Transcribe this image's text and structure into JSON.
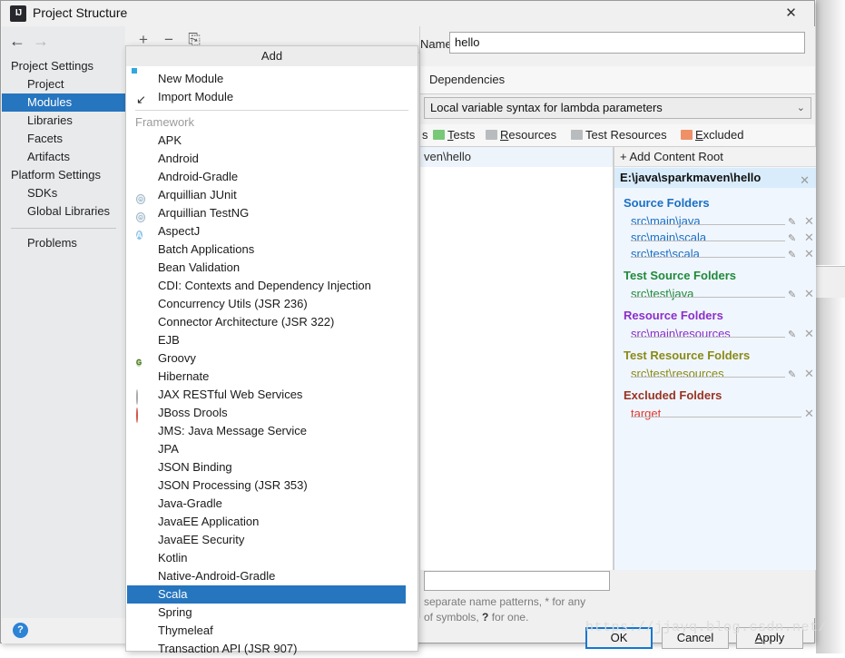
{
  "window": {
    "title": "Project Structure",
    "app_icon": "IJ",
    "close_icon": "✕"
  },
  "nav": {
    "back_icon": "←",
    "forward_icon": "→",
    "groups": [
      {
        "label": "Project Settings",
        "items": [
          {
            "label": "Project",
            "selected": false
          },
          {
            "label": "Modules",
            "selected": true
          },
          {
            "label": "Libraries",
            "selected": false
          },
          {
            "label": "Facets",
            "selected": false
          },
          {
            "label": "Artifacts",
            "selected": false
          }
        ]
      },
      {
        "label": "Platform Settings",
        "items": [
          {
            "label": "SDKs",
            "selected": false
          },
          {
            "label": "Global Libraries",
            "selected": false
          }
        ]
      }
    ],
    "problems": "Problems",
    "help_icon": "?"
  },
  "module_toolbar": {
    "add_icon": "+",
    "remove_icon": "−",
    "copy_icon": "⎘"
  },
  "right": {
    "name_label": "Name:",
    "name_value": "hello",
    "tabs": [
      {
        "label": "Dependencies",
        "selected": false
      }
    ],
    "language_level": "Local variable syntax for lambda parameters",
    "combo_arrow": "⌄",
    "mark_as": [
      {
        "label": "s",
        "color": "",
        "accesskey": ""
      },
      {
        "label": "Tests",
        "color": "#78c878",
        "accesskey": "T"
      },
      {
        "label": "Resources",
        "color": "#b9bcbf",
        "accesskey": "R"
      },
      {
        "label": "Test Resources",
        "color": "#b9bcbf",
        "accesskey": ""
      },
      {
        "label": "Excluded",
        "color": "#ef9068",
        "accesskey": "E"
      }
    ],
    "tree_root": "ven\\hello",
    "add_content_root": "+ Add Content Root",
    "add_content_root_accesskey": "C",
    "content_root_path": "E:\\java\\sparkmaven\\hello",
    "close_icon": "✕",
    "edit_icon": "✎",
    "folder_groups": [
      {
        "title": "Source Folders",
        "color": "#1a6fc4",
        "items": [
          {
            "path": "src\\main\\java",
            "has_edit": true
          },
          {
            "path": "src\\main\\scala",
            "has_edit": true
          },
          {
            "path": "src\\test\\scala",
            "has_edit": true
          }
        ]
      },
      {
        "title": "Test Source Folders",
        "color": "#1f8a3b",
        "items": [
          {
            "path": "src\\test\\java",
            "has_edit": true
          }
        ]
      },
      {
        "title": "Resource Folders",
        "color": "#8b2fc9",
        "items": [
          {
            "path": "src\\main\\resources",
            "has_edit": true
          }
        ]
      },
      {
        "title": "Test Resource Folders",
        "color": "#8a8a16",
        "items": [
          {
            "path": "src\\test\\resources",
            "has_edit": true
          }
        ]
      },
      {
        "title": "Excluded Folders",
        "color": "#993322",
        "items": [
          {
            "path": "target",
            "has_edit": false
          }
        ]
      }
    ],
    "exclude_hint_line1": "separate name patterns, * for any",
    "exclude_hint_line2_a": "of symbols, ",
    "exclude_hint_line2_b": "?",
    "exclude_hint_line2_c": " for one.",
    "buttons": [
      {
        "label": "OK",
        "default": true,
        "accesskey": ""
      },
      {
        "label": "Cancel",
        "default": false,
        "accesskey": ""
      },
      {
        "label": "Apply",
        "default": false,
        "accesskey": "A"
      }
    ]
  },
  "add_popup": {
    "title": "Add",
    "top_items": [
      {
        "label": "New Module",
        "icon": "new-module-icon"
      },
      {
        "label": "Import Module",
        "icon": "import-module-icon"
      }
    ],
    "category": "Framework",
    "items": [
      {
        "label": "APK",
        "icon": "android-icon",
        "selected": false
      },
      {
        "label": "Android",
        "icon": "android-icon",
        "selected": false
      },
      {
        "label": "Android-Gradle",
        "icon": "android-icon",
        "selected": false
      },
      {
        "label": "Arquillian JUnit",
        "icon": "arquillian-icon",
        "selected": false
      },
      {
        "label": "Arquillian TestNG",
        "icon": "arquillian-icon",
        "selected": false
      },
      {
        "label": "AspectJ",
        "icon": "aspectj-icon",
        "selected": false
      },
      {
        "label": "Batch Applications",
        "icon": "batch-icon",
        "selected": false
      },
      {
        "label": "Bean Validation",
        "icon": "bean-validation-icon",
        "selected": false
      },
      {
        "label": "CDI: Contexts and Dependency Injection",
        "icon": "cdi-icon",
        "selected": false
      },
      {
        "label": "Concurrency Utils (JSR 236)",
        "icon": "jsr-icon",
        "selected": false
      },
      {
        "label": "Connector Architecture (JSR 322)",
        "icon": "jsr-icon",
        "selected": false
      },
      {
        "label": "EJB",
        "icon": "jsr-icon",
        "selected": false
      },
      {
        "label": "Groovy",
        "icon": "groovy-icon",
        "selected": false
      },
      {
        "label": "Hibernate",
        "icon": "hibernate-icon",
        "selected": false
      },
      {
        "label": "JAX RESTful Web Services",
        "icon": "globe-icon",
        "selected": false
      },
      {
        "label": "JBoss Drools",
        "icon": "drools-icon",
        "selected": false
      },
      {
        "label": "JMS: Java Message Service",
        "icon": "jsr-icon",
        "selected": false
      },
      {
        "label": "JPA",
        "icon": "jpa-icon",
        "selected": false
      },
      {
        "label": "JSON Binding",
        "icon": "jsr-icon",
        "selected": false
      },
      {
        "label": "JSON Processing (JSR 353)",
        "icon": "jsr-icon",
        "selected": false
      },
      {
        "label": "Java-Gradle",
        "icon": "none-icon",
        "selected": false
      },
      {
        "label": "JavaEE Application",
        "icon": "javaee-icon",
        "selected": false
      },
      {
        "label": "JavaEE Security",
        "icon": "jsr-icon",
        "selected": false
      },
      {
        "label": "Kotlin",
        "icon": "kotlin-icon",
        "selected": false
      },
      {
        "label": "Native-Android-Gradle",
        "icon": "android-icon",
        "selected": false
      },
      {
        "label": "Scala",
        "icon": "scala-icon",
        "selected": true
      },
      {
        "label": "Spring",
        "icon": "spring-icon",
        "selected": false
      },
      {
        "label": "Thymeleaf",
        "icon": "thymeleaf-icon",
        "selected": false
      },
      {
        "label": "Transaction API (JSR 907)",
        "icon": "jsr-icon",
        "selected": false
      }
    ]
  },
  "watermark": "https://jjayq.blog.csdn.net/",
  "colors": {
    "accent": "#2675bf",
    "default_button_border": "#1277d3",
    "selection_bg": "#2675bf"
  }
}
